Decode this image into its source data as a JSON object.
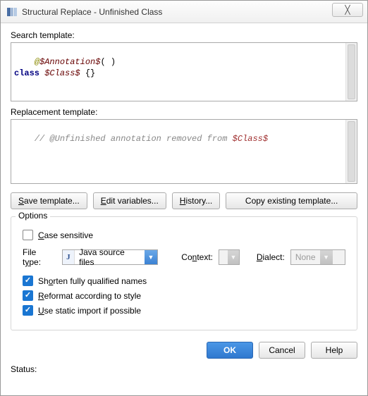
{
  "window": {
    "title": "Structural Replace - Unfinished Class"
  },
  "search": {
    "label": "Search template:",
    "code_html": "<span class=\"tok-anno\">@</span><span class=\"tok-var\">$Annotation$</span>( )\n<span class=\"tok-kw\">class</span> <span class=\"tok-var\">$Class$</span> {}"
  },
  "replace": {
    "label": "Replacement template:",
    "code_html": "// @Unfinished annotation removed from <span class=\"tok-var2\">$Class$</span>"
  },
  "buttons": {
    "save": "Save template...",
    "edit": "Edit variables...",
    "history": "History...",
    "copy": "Copy existing template..."
  },
  "options": {
    "legend": "Options",
    "case_sensitive": {
      "label": "Case sensitive",
      "checked": false
    },
    "filetype_label": "File type:",
    "filetype_value": "Java source files",
    "context_label": "Context:",
    "dialect_label": "Dialect:",
    "dialect_value": "None",
    "shorten": {
      "label": "Shorten fully qualified names",
      "checked": true
    },
    "reformat": {
      "label": "Reformat according to style",
      "checked": true
    },
    "static_import": {
      "label": "Use static import if possible",
      "checked": true
    }
  },
  "footer": {
    "ok": "OK",
    "cancel": "Cancel",
    "help": "Help"
  },
  "status_label": "Status:"
}
